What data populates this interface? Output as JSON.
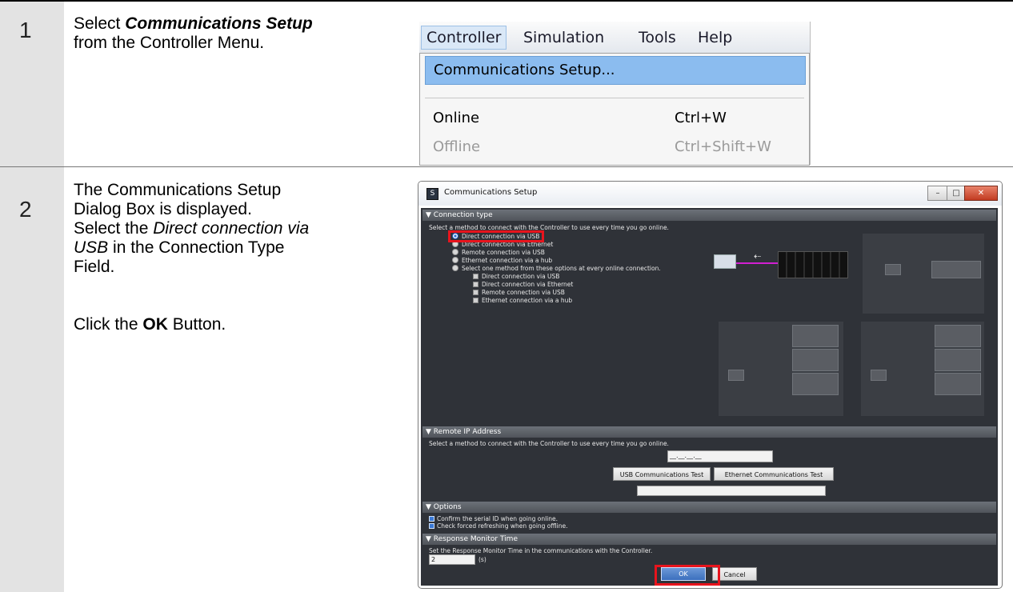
{
  "steps": [
    {
      "number": "1",
      "text_lines": [
        {
          "pre": "Select ",
          "bold_italic": "Communications Setup",
          "post": ""
        },
        {
          "pre": "from the Controller Menu.",
          "bold_italic": "",
          "post": ""
        }
      ]
    },
    {
      "number": "2",
      "line1": "The Communications Setup",
      "line2": "Dialog Box is displayed.",
      "line3_pre": "Select the ",
      "line3_italic": "Direct connection via",
      "line4_italic": "USB",
      "line4_post": " in the Connection Type",
      "line5": "Field.",
      "click_pre": "Click the ",
      "click_bold": "OK",
      "click_post": " Button."
    }
  ],
  "menu": {
    "bar": [
      "Controller",
      "Simulation",
      "Tools",
      "Help"
    ],
    "items": [
      {
        "label": "Communications Setup...",
        "shortcut": "",
        "state": "highlighted"
      },
      {
        "label": "Online",
        "shortcut": "Ctrl+W",
        "state": "normal"
      },
      {
        "label": "Offline",
        "shortcut": "Ctrl+Shift+W",
        "state": "disabled"
      }
    ]
  },
  "dialog": {
    "title": "Communications Setup",
    "icon": "app-s-icon",
    "window_buttons": [
      "minimize-icon",
      "maximize-icon",
      "close-icon"
    ],
    "connection_type": {
      "header": "Connection type",
      "instruction": "Select a method to connect with the Controller to use every time you go online.",
      "options": [
        {
          "label": "Direct connection via USB",
          "selected": true
        },
        {
          "label": "Direct connection via Ethernet",
          "selected": false
        },
        {
          "label": "Remote connection via USB",
          "selected": false
        },
        {
          "label": "Ethernet connection via a hub",
          "selected": false
        },
        {
          "label": "Select one method from these options at every online connection.",
          "selected": false
        }
      ],
      "sub_options": [
        "Direct connection via USB",
        "Direct connection via Ethernet",
        "Remote connection via USB",
        "Ethernet connection via a hub"
      ]
    },
    "remote_ip": {
      "header": "Remote IP Address",
      "instruction": "Select a method to connect with the Controller to use every time you go online.",
      "ip_placeholder": "__.__.__.__",
      "usb_test_label": "USB Communications Test",
      "ethernet_test_label": "Ethernet Communications Test"
    },
    "options": {
      "header": "Options",
      "checks": [
        {
          "label": "Confirm the serial ID when going online.",
          "checked": true
        },
        {
          "label": "Check forced refreshing when going offline.",
          "checked": true
        }
      ]
    },
    "response_time": {
      "header": "Response Monitor Time",
      "instruction": "Set the Response Monitor Time in the communications with the Controller.",
      "value": "2",
      "unit": "(s)"
    },
    "ok_label": "OK",
    "cancel_label": "Cancel"
  },
  "colors": {
    "highlight_red": "#e8141d",
    "menu_highlight": "#8bbcef",
    "dialog_dark": "#2f3238",
    "step_column_gray": "#e3e3e3"
  }
}
